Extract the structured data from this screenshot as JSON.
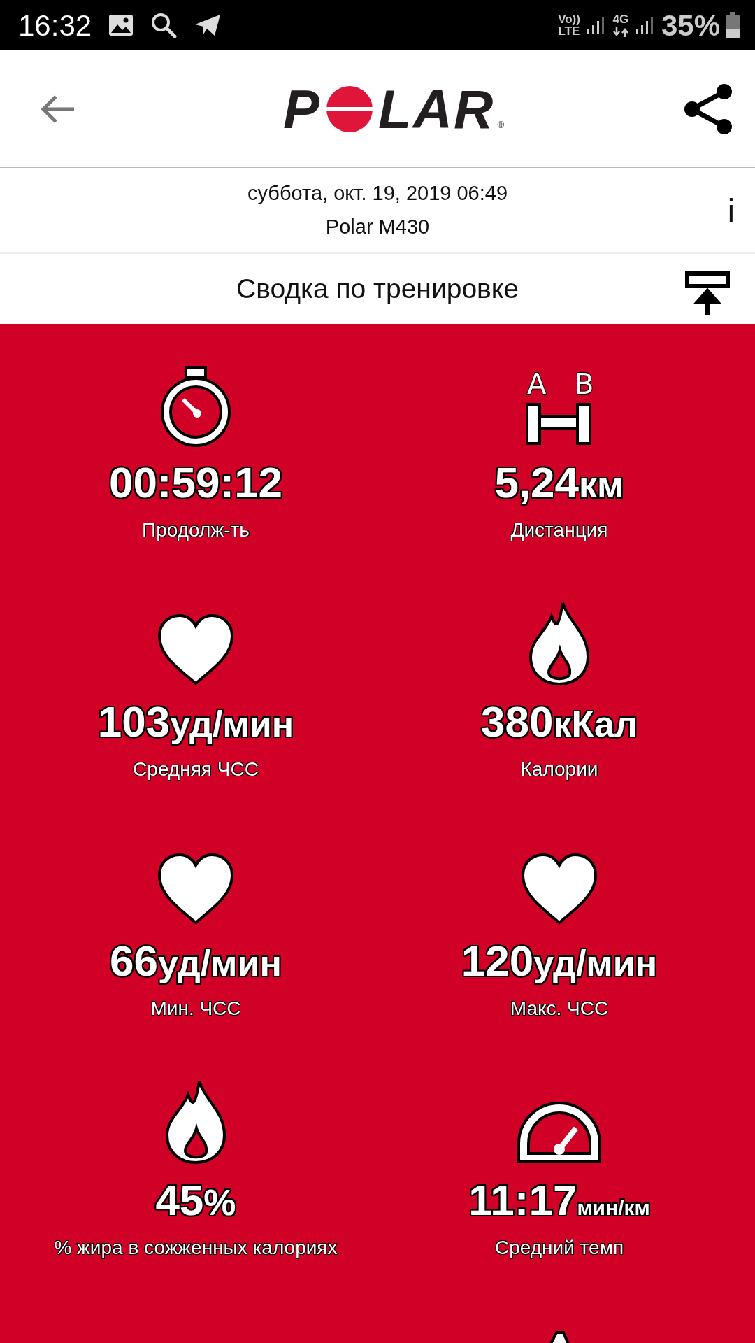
{
  "status_bar": {
    "time": "16:32",
    "volte": [
      "Vo))",
      "LTE"
    ],
    "network": "4G",
    "battery": "35%"
  },
  "header": {
    "logo_parts": [
      "P",
      "LAR"
    ],
    "logo_mark": "®"
  },
  "session": {
    "date": "суббота, окт. 19, 2019 06:49",
    "device": "Polar M430",
    "info": "i"
  },
  "section": {
    "title": "Сводка по тренировке"
  },
  "distance_icon_letters": [
    "A",
    "B"
  ],
  "metrics": [
    {
      "kind": "duration",
      "value": "00:59:12",
      "label": "Продолж-ть"
    },
    {
      "kind": "distance",
      "value": "5,24",
      "unit": "км",
      "label": "Дистанция"
    },
    {
      "kind": "heart-rate",
      "value": "103",
      "unit": "уд/мин",
      "label": "Средняя ЧСС"
    },
    {
      "kind": "energy",
      "value": "380",
      "unit": "кКал",
      "label": "Калории"
    },
    {
      "kind": "heart-rate",
      "value": "66",
      "unit": "уд/мин",
      "label": "Мин. ЧСС"
    },
    {
      "kind": "heart-rate",
      "value": "120",
      "unit": "уд/мин",
      "label": "Макс. ЧСС"
    },
    {
      "kind": "energy",
      "value": "45",
      "unit": "%",
      "label": "% жира в сожженных калориях"
    },
    {
      "kind": "pace",
      "value": "11:17",
      "unit": "мин/км",
      "label": "Средний темп"
    }
  ]
}
